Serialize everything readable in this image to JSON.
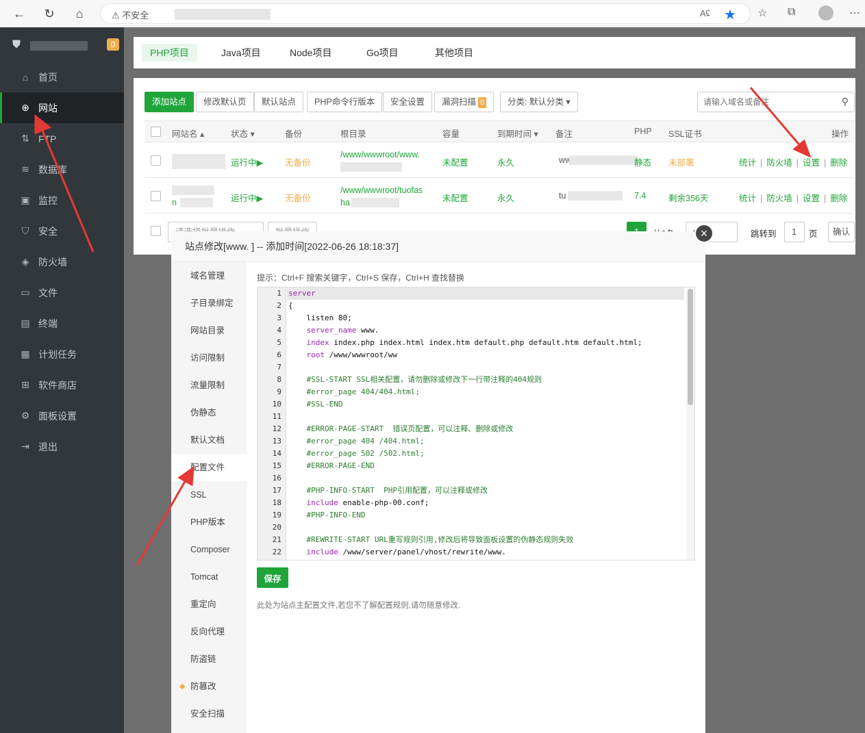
{
  "browser": {
    "insecure_label": "不安全",
    "read_aloud": "Aʢ"
  },
  "sidebar": {
    "badge": "0",
    "items": [
      {
        "label": "首页",
        "icon": "home-icon",
        "glyph": "⌂"
      },
      {
        "label": "网站",
        "icon": "globe-icon",
        "glyph": "⊕"
      },
      {
        "label": "FTP",
        "icon": "ftp-icon",
        "glyph": "⇅"
      },
      {
        "label": "数据库",
        "icon": "database-icon",
        "glyph": "≋"
      },
      {
        "label": "监控",
        "icon": "monitor-icon",
        "glyph": "▣"
      },
      {
        "label": "安全",
        "icon": "shield-icon",
        "glyph": "⛉"
      },
      {
        "label": "防火墙",
        "icon": "firewall-icon",
        "glyph": "◈"
      },
      {
        "label": "文件",
        "icon": "folder-icon",
        "glyph": "▭"
      },
      {
        "label": "终端",
        "icon": "terminal-icon",
        "glyph": "▤"
      },
      {
        "label": "计划任务",
        "icon": "calendar-icon",
        "glyph": "▦"
      },
      {
        "label": "软件商店",
        "icon": "apps-icon",
        "glyph": "⊞"
      },
      {
        "label": "面板设置",
        "icon": "gear-icon",
        "glyph": "⚙"
      },
      {
        "label": "退出",
        "icon": "logout-icon",
        "glyph": "⇥"
      }
    ]
  },
  "tabs": [
    "PHP项目",
    "Java项目",
    "Node项目",
    "Go项目",
    "其他项目"
  ],
  "toolbar": {
    "add_site": "添加站点",
    "modify_default": "修改默认页",
    "default_site": "默认站点",
    "php_cli": "PHP命令行版本",
    "security": "安全设置",
    "vuln_scan": "漏洞扫描",
    "vuln_count": "0",
    "category": "分类: 默认分类 ▾",
    "search_placeholder": "请输入域名或备注"
  },
  "table": {
    "headers": {
      "name": "网站名 ▴",
      "status": "状态 ▾",
      "backup": "备份",
      "root": "根目录",
      "capacity": "容量",
      "expire": "到期时间 ▾",
      "remark": "备注",
      "php": "PHP",
      "ssl": "SSL证书",
      "ops": "操作"
    },
    "rows": [
      {
        "name": "",
        "status": "运行中▶",
        "backup": "无备份",
        "root_line1": "/www/wwwroot/www.",
        "root_line2": "",
        "capacity": "未配置",
        "expire": "永久",
        "remark": "ww",
        "php": "静态",
        "ssl": "未部署",
        "ops": [
          "统计",
          "防火墙",
          "设置",
          "删除"
        ]
      },
      {
        "name": "n",
        "status": "运行中▶",
        "backup": "无备份",
        "root_line1": "/www/wwwroot/tuofas",
        "root_line2": "ha",
        "capacity": "未配置",
        "expire": "永久",
        "remark": "tu",
        "php": "7.4",
        "ssl": "剩余356天",
        "ops": [
          "统计",
          "防火墙",
          "设置",
          "删除"
        ]
      }
    ]
  },
  "pager": {
    "batch_placeholder": "请选择批量操作",
    "batch_button": "批量操作",
    "current_page": "1",
    "total": "共2条",
    "jump_label": "跳转到",
    "jump_value": "1",
    "page_unit": "页",
    "confirm": "确认"
  },
  "dialog": {
    "title": "站点修改[www.                ] -- 添加时间[2022-06-26 18:18:37]",
    "close": "×",
    "menu": [
      "域名管理",
      "子目录绑定",
      "网站目录",
      "访问限制",
      "流量限制",
      "伪静态",
      "默认文档",
      "配置文件",
      "SSL",
      "PHP版本",
      "Composer",
      "Tomcat",
      "重定向",
      "反向代理",
      "防盗链",
      "防篡改",
      "安全扫描"
    ],
    "hint": "提示：Ctrl+F 搜索关键字，Ctrl+S 保存，Ctrl+H 查找替换",
    "save": "保存",
    "note": "此处为站点主配置文件,若您不了解配置规则,请勿随意修改.",
    "code_lines": [
      "server",
      "{",
      "    listen 80;",
      "    server_name www.",
      "    index index.php index.html index.htm default.php default.htm default.html;",
      "    root /www/wwwroot/ww",
      "",
      "    #SSL-START SSL相关配置，请勿删除或修改下一行带注释的404规则",
      "    #error_page 404/404.html;",
      "    #SSL-END",
      "",
      "    #ERROR-PAGE-START  错误页配置，可以注释、删除或修改",
      "    #error_page 404 /404.html;",
      "    #error_page 502 /502.html;",
      "    #ERROR-PAGE-END",
      "",
      "    #PHP-INFO-START  PHP引用配置，可以注释或修改",
      "    include enable-php-00.conf;",
      "    #PHP-INFO-END",
      "",
      "    #REWRITE-START URL重写规则引用,修改后将导致面板设置的伪静态规则失效",
      "    include /www/server/panel/vhost/rewrite/www."
    ]
  },
  "colors": {
    "accent": "#20a53a",
    "sidebar_bg": "#32373c",
    "warning": "#f0ad4e",
    "annotation_arrow": "#e53935"
  }
}
